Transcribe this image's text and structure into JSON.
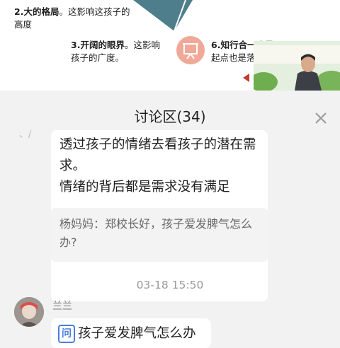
{
  "slide": {
    "point2_title": "2.大的格局",
    "point2_body": "。这影响这孩子的高度",
    "point3_title": "3.开阔的眼界",
    "point3_body": "。这影响孩子的广度。",
    "point6_title": "6.知行合一",
    "point6_body": "这是起点也是落脚点",
    "brand_color": "#4e7d8c"
  },
  "discussion": {
    "title": "讨论区(34)",
    "stub_text": "、/",
    "reply_lines": [
      "透过孩子的情绪去看孩子的潜在需求。",
      "情绪的背后都是需求没有满足"
    ],
    "quoted": "杨妈妈：郑校长好，孩子爱发脾气怎么办?",
    "timestamp": "03-18 15:50",
    "next_user": "兰兰",
    "question_badge": "问",
    "question_text": "孩子爱发脾气怎么办"
  }
}
